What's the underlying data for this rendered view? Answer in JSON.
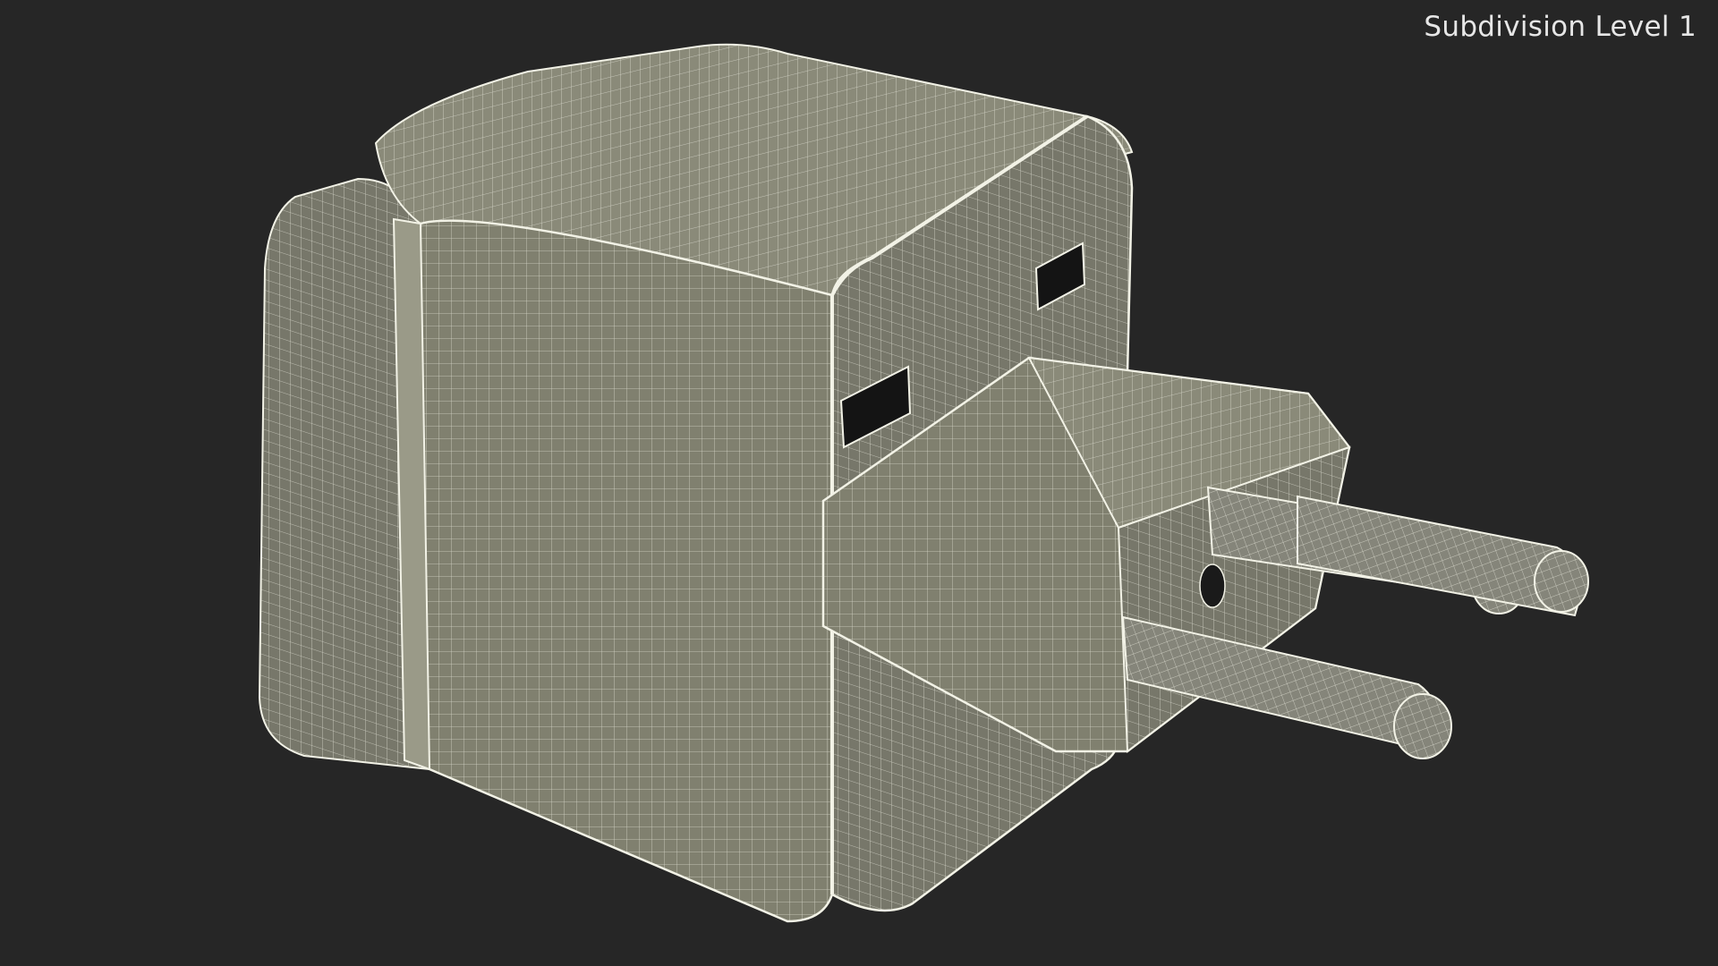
{
  "viewport": {
    "overlay_label": "Subdivision Level 1"
  },
  "colors": {
    "background": "#262626",
    "surface": "#80806f",
    "surface_light": "#8f8f7e",
    "surface_dark": "#6b6b5c",
    "wire": "#f2f2e6",
    "slot": "#141414"
  },
  "model": {
    "icon": "wireframe-plug-adapter"
  }
}
